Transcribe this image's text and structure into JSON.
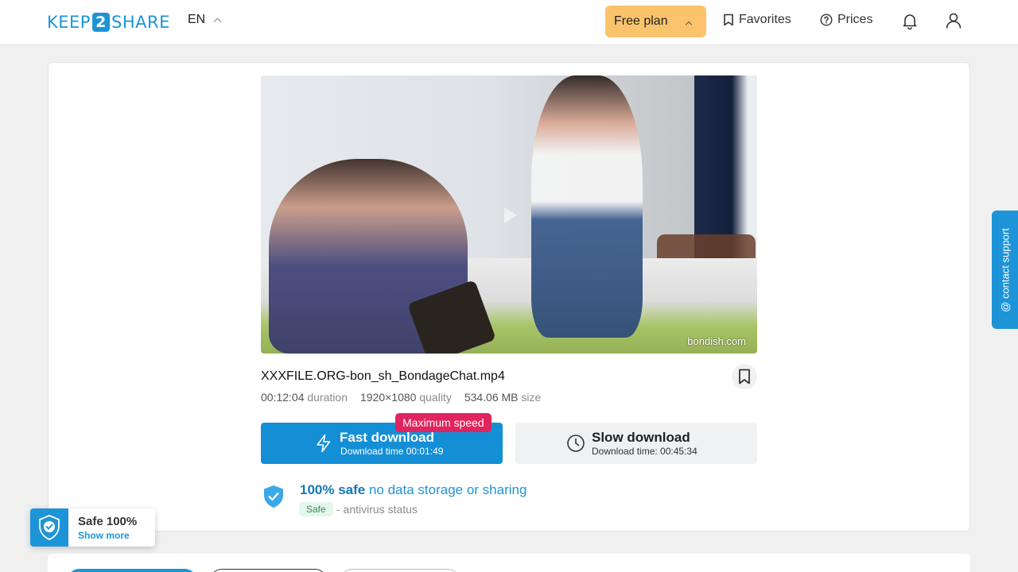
{
  "header": {
    "logo_left": "KEEP",
    "logo_mid": "2",
    "logo_right": "SHARE",
    "language": "EN",
    "plan_label": "Free plan",
    "favorites_label": "Favorites",
    "prices_label": "Prices"
  },
  "file": {
    "name": "XXXFILE.ORG-bon_sh_BondageChat.mp4",
    "duration_value": "00:12:04",
    "duration_label": "duration",
    "quality_value": "1920×1080",
    "quality_label": "quality",
    "size_value": "534.06 MB",
    "size_label": "size",
    "watermark": "bondish.com"
  },
  "download": {
    "fast_title": "Fast download",
    "fast_subtitle": "Download time 00:01:49",
    "max_speed_badge": "Maximum speed",
    "slow_title": "Slow download",
    "slow_subtitle": "Download time: 00:45:34"
  },
  "safety": {
    "title_bold": "100% safe",
    "title_rest": "no data storage or sharing",
    "badge": "Safe",
    "status": "- antivirus status"
  },
  "contact_support": "@ contact support",
  "safe_widget": {
    "title": "Safe 100%",
    "link": "Show more"
  },
  "colors": {
    "brand": "#1d94d8",
    "plan_button": "#fbc36b",
    "max_speed": "#e0245e"
  }
}
